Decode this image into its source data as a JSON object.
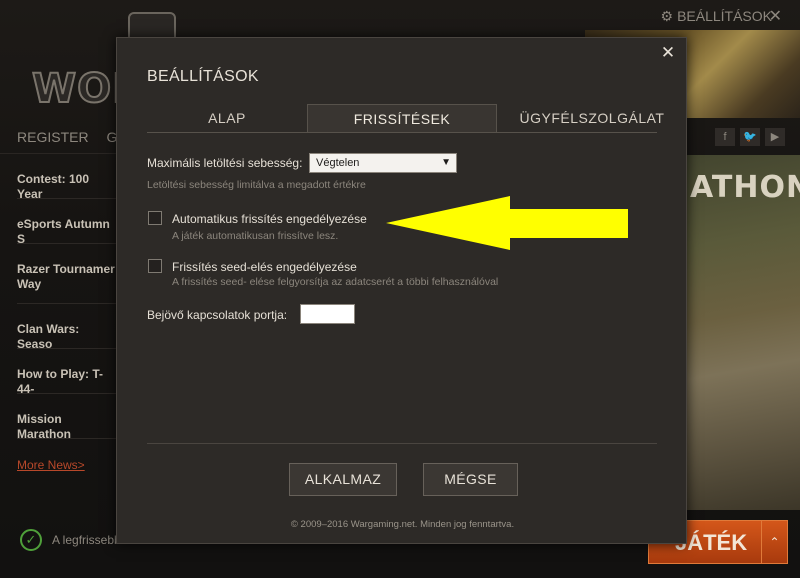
{
  "background": {
    "logo_text": "WORL",
    "top_settings_label": "BEÁLLÍTÁSOK",
    "close_glyph": "✕",
    "links": [
      "REGISTER",
      "GET G"
    ],
    "news": [
      "Contest: 100 Year",
      "eSports Autumn S",
      "Razer Tournamer Way",
      "Clan Wars: Seaso",
      "How to Play: T-44-",
      "Mission Marathon"
    ],
    "more_news": "More News>",
    "status_text": "A legfrissebb",
    "banner_title": "ATHON",
    "play_label": "JÁTÉK",
    "social": [
      "f",
      "🐦",
      "▶"
    ]
  },
  "modal": {
    "title": "BEÁLLÍTÁSOK",
    "close": "✕",
    "tabs": [
      {
        "label": "ALAP",
        "active": false
      },
      {
        "label": "FRISSÍTÉSEK",
        "active": true
      },
      {
        "label": "ÜGYFÉLSZOLGÁLAT",
        "active": false
      }
    ],
    "speed": {
      "label": "Maximális letöltési sebesség:",
      "value": "Végtelen",
      "hint": "Letöltési sebesség limitálva a megadott értékre"
    },
    "auto_update": {
      "label": "Automatikus frissítés engedélyezése",
      "hint": "A játék automatikusan frissítve lesz.",
      "checked": false
    },
    "seeding": {
      "label": "Frissítés seed-elés engedélyezése",
      "hint": "A frissítés seed- elése felgyorsítja az adatcserét a többi felhasználóval",
      "checked": false
    },
    "port": {
      "label": "Bejövő kapcsolatok portja:",
      "value": ""
    },
    "apply_button": "ALKALMAZ",
    "cancel_button": "MÉGSE",
    "footer": "© 2009–2016 Wargaming.net. Minden jog fenntartva."
  },
  "colors": {
    "annotation_arrow": "#ffff00",
    "play_button": "#c24a14",
    "modal_bg": "#2d2a27"
  }
}
